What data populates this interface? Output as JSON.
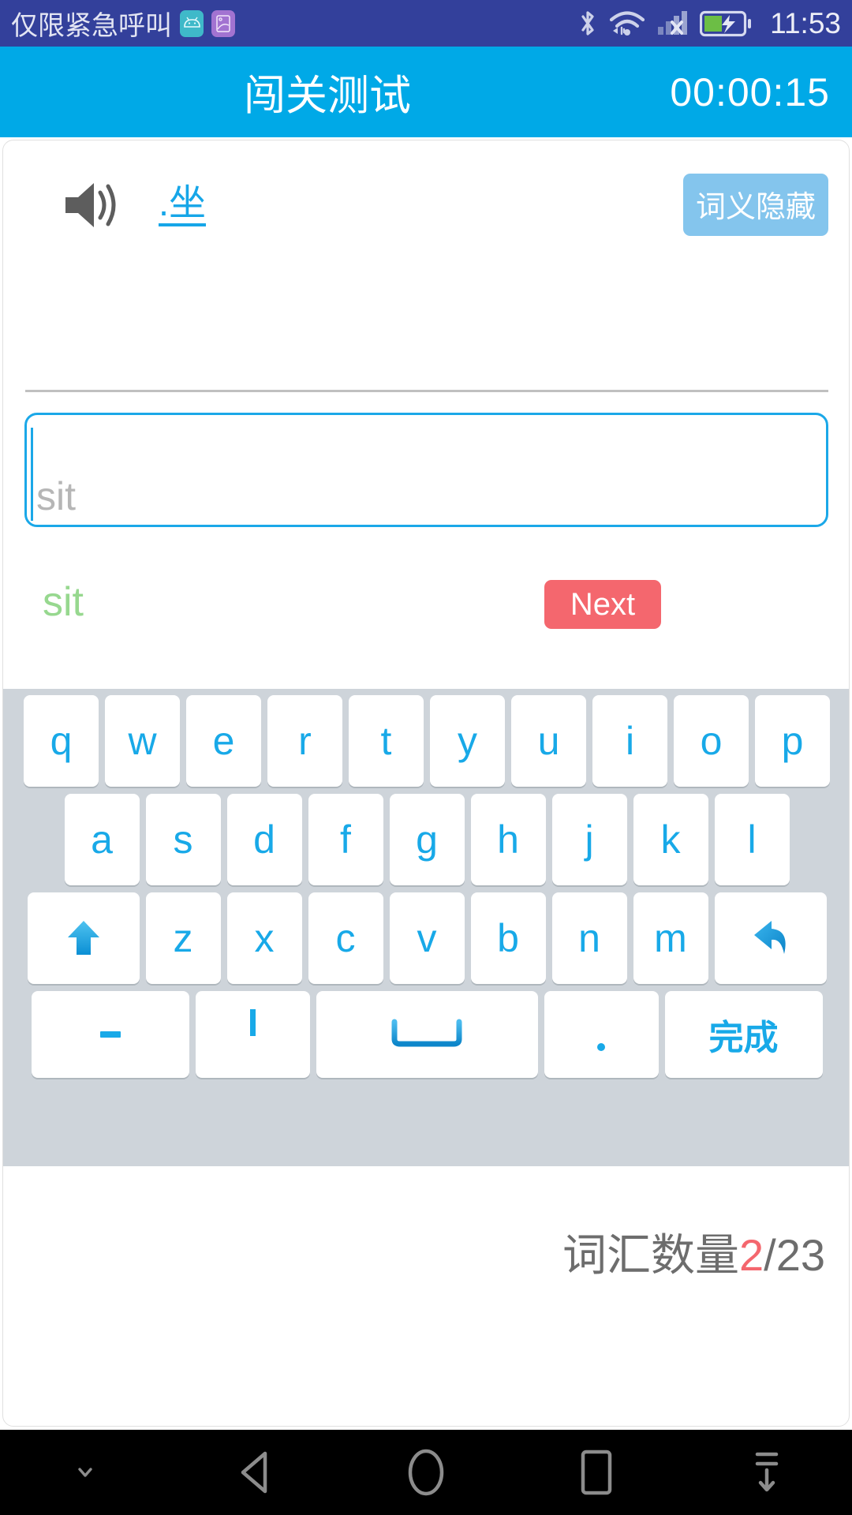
{
  "status_bar": {
    "carrier": "仅限紧急呼叫",
    "app_icons": [
      "android-app-icon",
      "gallery-app-icon"
    ],
    "icons": [
      "bluetooth-icon",
      "wifi-icon",
      "cellular-signal-icon",
      "battery-charging-icon"
    ],
    "clock": "11:53",
    "background_color": "#33409b",
    "text_color": "#e3e5f3",
    "battery_fill_color": "#6cbe45"
  },
  "title_bar": {
    "title": "闯关测试",
    "timer": "00:00:15",
    "background_color": "#00a9e7"
  },
  "card": {
    "word": {
      "speaker_icon": "speaker-icon",
      "text": ".坐",
      "color": "#16a6e8"
    },
    "hide_meaning_button": {
      "label": "词义隐藏",
      "background_color": "#84c5ed",
      "text_color": "#ffffff"
    },
    "answer_input": {
      "value": "",
      "placeholder": "sit",
      "border_color": "#1ba8e8",
      "placeholder_color": "#b6b6b6"
    },
    "correct_answer": {
      "text": "sit",
      "color": "#97d88f"
    },
    "next_button": {
      "label": "Next",
      "background_color": "#f4676e",
      "text_color": "#ffffff"
    }
  },
  "keyboard": {
    "background_color": "#ced4da",
    "key_text_color": "#18a9e8",
    "row1": [
      "q",
      "w",
      "e",
      "r",
      "t",
      "y",
      "u",
      "i",
      "o",
      "p"
    ],
    "row2": [
      "a",
      "s",
      "d",
      "f",
      "g",
      "h",
      "j",
      "k",
      "l"
    ],
    "row3_letters": [
      "z",
      "x",
      "c",
      "v",
      "b",
      "n",
      "m"
    ],
    "shift_key": "shift-icon",
    "backspace_key": "backspace-icon",
    "row4": {
      "dash": "-",
      "apostrophe": "'",
      "space": "space-icon",
      "period": ".",
      "done": "完成"
    }
  },
  "footer": {
    "counter_label": "词汇数量",
    "current": "2",
    "separator": "/",
    "total": "23",
    "current_color": "#f4676e",
    "label_color": "#6d6d6d"
  },
  "nav_bar": {
    "buttons": [
      "hide-keyboard-icon",
      "back-icon",
      "home-icon",
      "recents-icon",
      "collapse-icon"
    ],
    "background_color": "#000000",
    "icon_color": "#8c8c8c"
  }
}
